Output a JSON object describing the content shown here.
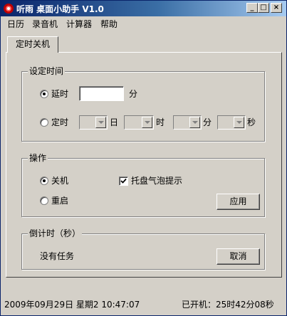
{
  "window": {
    "title": "听雨  桌面小助手  V1.0",
    "controls": {
      "minimize": "_",
      "maximize": "□",
      "close": "×"
    }
  },
  "menu": [
    "日历",
    "录音机",
    "计算器",
    "帮助"
  ],
  "tab": {
    "label": "定时关机"
  },
  "time_group": {
    "title": "设定时间",
    "delay_label": "延时",
    "delay_value": "",
    "delay_unit": "分",
    "scheduled_label": "定时",
    "unit_day": "日",
    "unit_hour": "时",
    "unit_minute": "分",
    "unit_second": "秒",
    "selected": "延时"
  },
  "action_group": {
    "title": "操作",
    "shutdown_label": "关机",
    "restart_label": "重启",
    "tray_tip_label": "托盘气泡提示",
    "tray_tip_checked": true,
    "apply_label": "应用",
    "selected": "关机"
  },
  "countdown_group": {
    "title": "倒计时（秒）",
    "status": "没有任务",
    "cancel_label": "取消"
  },
  "status": {
    "datetime": "2009年09月29日  星期2  10:47:07",
    "uptime": "已开机：25时42分08秒"
  },
  "icons": [
    "app-logo-icon",
    "minimize-icon",
    "maximize-icon",
    "close-icon",
    "dropdown-arrow-icon",
    "checkmark-icon"
  ]
}
